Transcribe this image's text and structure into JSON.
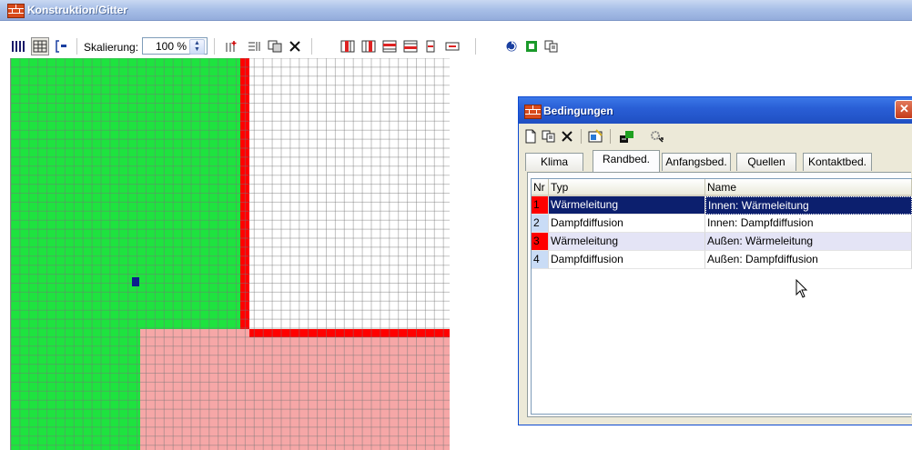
{
  "window": {
    "title": "Konstruktion/Gitter"
  },
  "toolbar": {
    "scale_label": "Skalierung:",
    "scale_value": "100 %"
  },
  "grid": {
    "colors": {
      "green": "#1ee33f",
      "red": "#ff0000",
      "pink": "#f6a7a7",
      "white": "#ffffff",
      "marker": "#0c1e8c"
    }
  },
  "dialog": {
    "title": "Bedingungen",
    "close_glyph": "✕",
    "tabs": [
      "Klima",
      "Randbed.",
      "Anfangsbed.",
      "Quellen",
      "Kontaktbed."
    ],
    "active_tab": "Randbed.",
    "columns": [
      "Nr",
      "Typ",
      "Name"
    ],
    "rows": [
      {
        "nr": "1",
        "typ": "Wärmeleitung",
        "name": "Innen: Wärmeleitung",
        "nr_color": "#ff0000",
        "selected": true
      },
      {
        "nr": "2",
        "typ": "Dampfdiffusion",
        "name": "Innen: Dampfdiffusion",
        "nr_color": "#c9dcf6",
        "selected": false
      },
      {
        "nr": "3",
        "typ": "Wärmeleitung",
        "name": "Außen: Wärmeleitung",
        "nr_color": "#ff0000",
        "selected": false
      },
      {
        "nr": "4",
        "typ": "Dampfdiffusion",
        "name": "Außen: Dampfdiffusion",
        "nr_color": "#c9dcf6",
        "selected": false
      }
    ]
  },
  "icons": {
    "main_toolbar": [
      "columns-icon",
      "grid-icon",
      "bracket-icon",
      "grid-add-icon",
      "grid-split-icon",
      "grid-copy-icon",
      "delete-icon",
      "insert-col-left-icon",
      "insert-col-right-icon",
      "insert-row-top-icon",
      "insert-row-bottom-icon",
      "delete-col-icon",
      "delete-row-icon",
      "refresh-icon",
      "square-icon",
      "copy-icon"
    ],
    "dialog_toolbar": [
      "new-icon",
      "copy-icon",
      "delete-icon",
      "image-icon",
      "assign-icon",
      "settings-icon"
    ]
  }
}
